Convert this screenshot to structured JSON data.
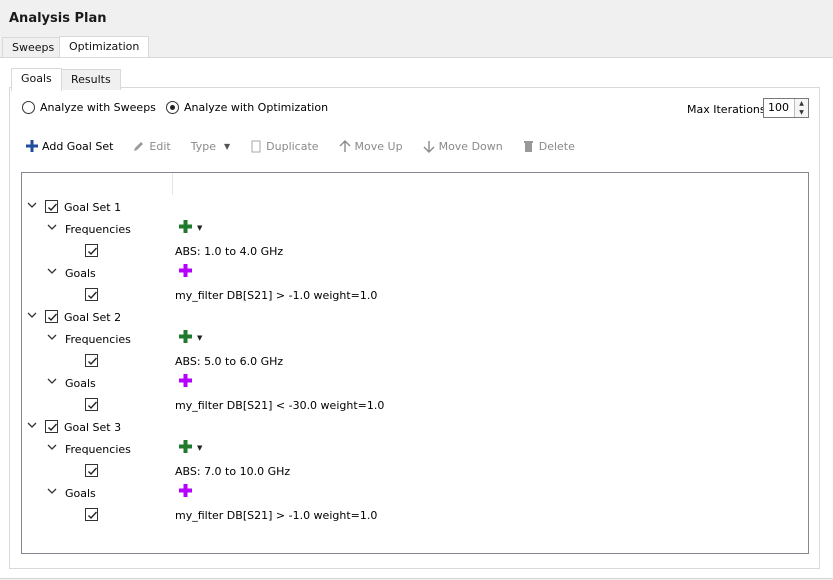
{
  "title": "Analysis Plan",
  "outer_tabs": [
    "Sweeps",
    "Optimization"
  ],
  "inner_tabs": [
    "Goals",
    "Results"
  ],
  "mode": {
    "sweeps_label": "Analyze with Sweeps",
    "optimization_label": "Analyze with Optimization",
    "selected": "optimization"
  },
  "max_iterations": {
    "label": "Max Iterations",
    "value": "100"
  },
  "toolbar": {
    "add_goal_set": "Add Goal Set",
    "edit": "Edit",
    "type": "Type",
    "duplicate": "Duplicate",
    "move_up": "Move Up",
    "move_down": "Move Down",
    "delete": "Delete"
  },
  "colors": {
    "freq_add": "#1f7a2e",
    "goal_add": "#b300ff",
    "add_goal_set_icon": "#1e4e9a"
  },
  "tree": {
    "frequencies_label": "Frequencies",
    "goals_label": "Goals",
    "goal_sets": [
      {
        "name": "Goal Set 1",
        "frequency": "ABS: 1.0 to 4.0 GHz",
        "goal": "my_filter DB[S21] > -1.0 weight=1.0"
      },
      {
        "name": "Goal Set 2",
        "frequency": "ABS: 5.0 to 6.0 GHz",
        "goal": "my_filter DB[S21] < -30.0 weight=1.0"
      },
      {
        "name": "Goal Set 3",
        "frequency": "ABS: 7.0 to 10.0 GHz",
        "goal": "my_filter DB[S21] > -1.0 weight=1.0"
      }
    ]
  }
}
